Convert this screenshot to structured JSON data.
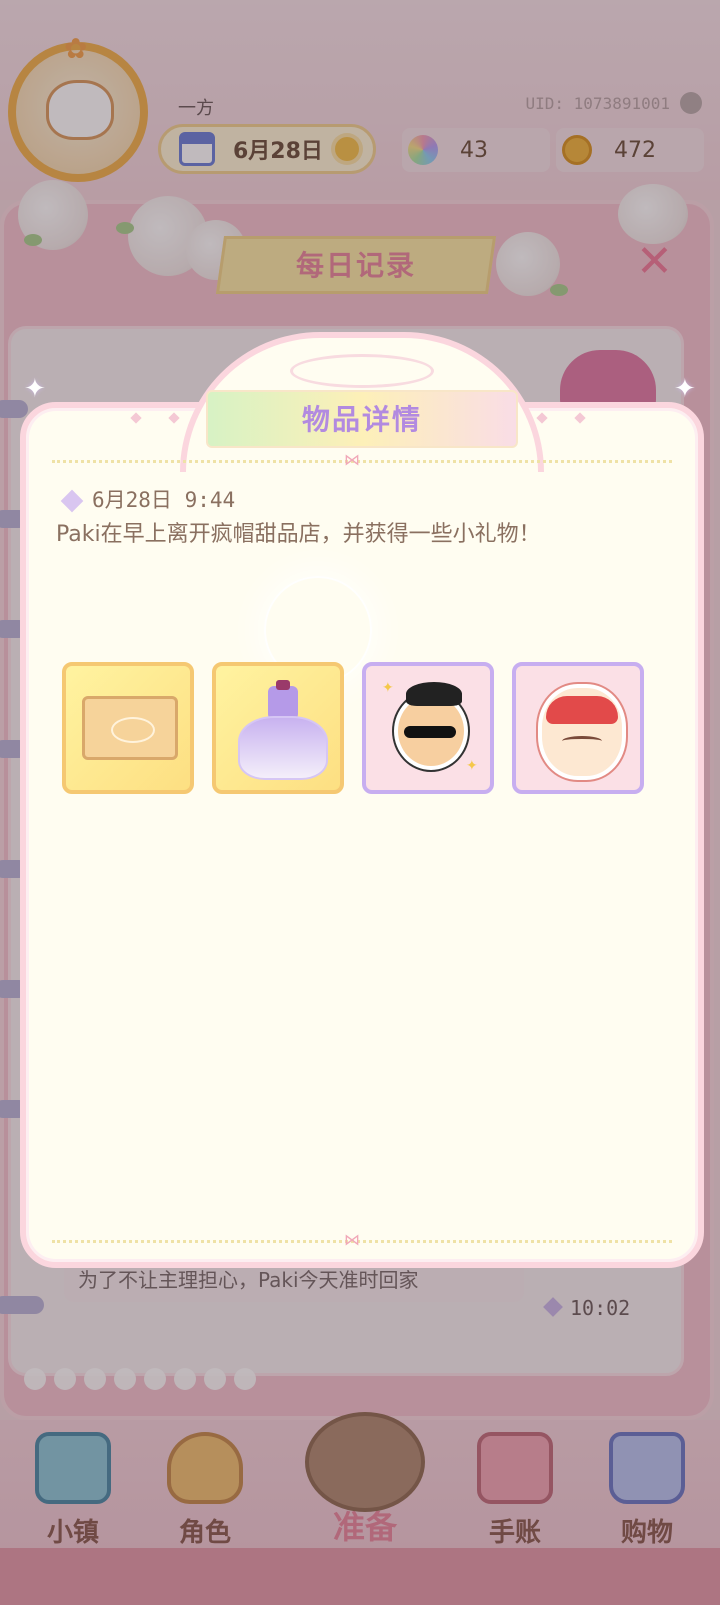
{
  "header": {
    "player_name": "一方",
    "uid": "UID: 1073891001",
    "date": "6月28日",
    "gems": "43",
    "coins": "472"
  },
  "record_panel": {
    "title": "每日记录",
    "close_icon": "close-x-icon",
    "bottom_entry_text": "为了不让主理担心，Paki今天准时回家",
    "bottom_entry_time": "10:02"
  },
  "modal": {
    "title": "物品详情",
    "entry_time": "6月28日 9:44",
    "entry_text": "Paki在早上离开疯帽甜品店，并获得一些小礼物！",
    "items": [
      {
        "name": "parcel-box-icon",
        "frame": "gold"
      },
      {
        "name": "purple-dress-icon",
        "frame": "gold"
      },
      {
        "name": "sunglasses-sticker-icon",
        "frame": "purple"
      },
      {
        "name": "lion-dance-sticker-icon",
        "frame": "purple"
      }
    ]
  },
  "nav": {
    "town": "小镇",
    "role": "角色",
    "prepare": "准备",
    "journal": "手账",
    "shop": "购物"
  },
  "colors": {
    "accent_pink": "#e9869c",
    "title_purple": "#b28ae0",
    "modal_bg": "#fffdf1",
    "modal_border": "#fbd6de"
  }
}
